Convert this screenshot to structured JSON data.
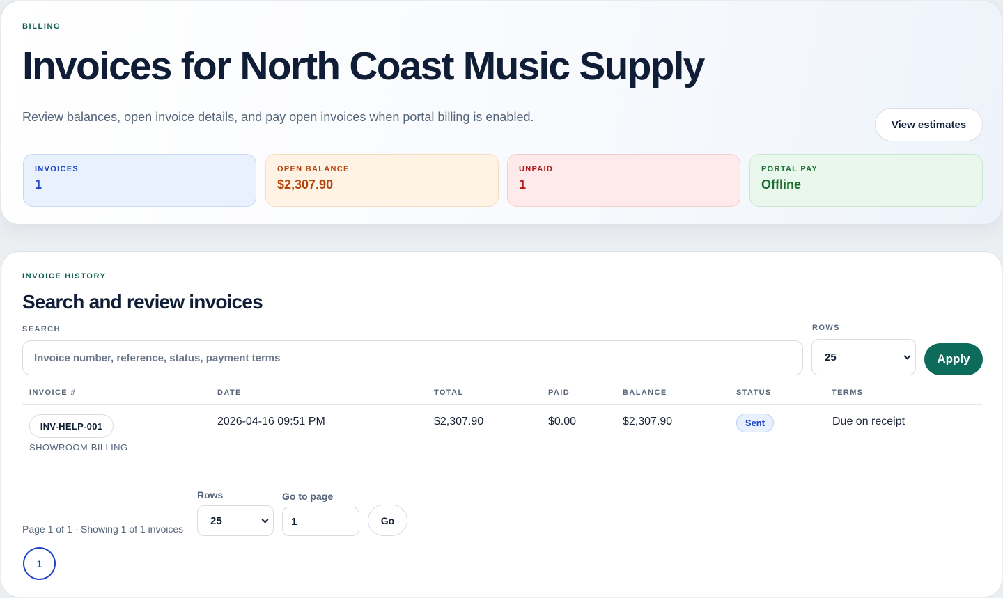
{
  "header": {
    "eyebrow": "BILLING",
    "title": "Invoices for North Coast Music Supply",
    "subtitle": "Review balances, open invoice details, and pay open invoices when portal billing is enabled.",
    "view_estimates_label": "View estimates"
  },
  "stats": [
    {
      "label": "INVOICES",
      "value": "1"
    },
    {
      "label": "OPEN BALANCE",
      "value": "$2,307.90"
    },
    {
      "label": "UNPAID",
      "value": "1"
    },
    {
      "label": "PORTAL PAY",
      "value": "Offline"
    }
  ],
  "history": {
    "eyebrow": "INVOICE HISTORY",
    "title": "Search and review invoices",
    "search_label": "SEARCH",
    "search_placeholder": "Invoice number, reference, status, payment terms",
    "rows_label": "ROWS",
    "rows_value": "25",
    "apply_label": "Apply"
  },
  "table": {
    "columns": [
      "INVOICE #",
      "DATE",
      "TOTAL",
      "PAID",
      "BALANCE",
      "STATUS",
      "TERMS"
    ],
    "rows": [
      {
        "invoice_number": "INV-HELP-001",
        "reference": "SHOWROOM-BILLING",
        "date": "2026-04-16 09:51 PM",
        "total": "$2,307.90",
        "paid": "$0.00",
        "balance": "$2,307.90",
        "status": "Sent",
        "terms": "Due on receipt"
      }
    ]
  },
  "pagination": {
    "summary": "Page 1 of 1 · Showing 1 of 1 invoices",
    "rows_label": "Rows",
    "rows_value": "25",
    "goto_label": "Go to page",
    "goto_value": "1",
    "go_label": "Go",
    "current_page": "1"
  },
  "colors": {
    "accent": "#0c6b5b",
    "title": "#0f1e36",
    "invoices": "#1f44c4",
    "open_balance": "#b4460b",
    "unpaid": "#b3161b",
    "portal_pay": "#1b6e2f"
  }
}
